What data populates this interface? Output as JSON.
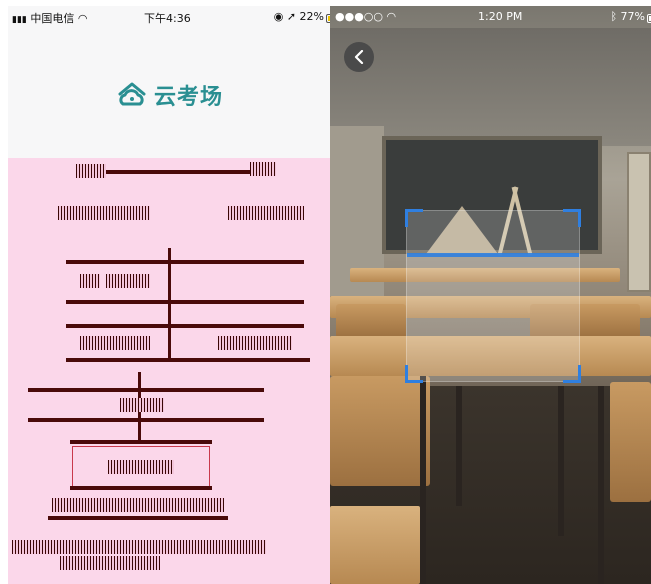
{
  "left_screen": {
    "status": {
      "carrier": "中国电信",
      "time": "下午4:36",
      "battery": "22%"
    },
    "logo": {
      "text": "云考场",
      "icon": "home-cloud-icon",
      "color": "#2a8f92"
    },
    "garbled_region_color": "#fbd7ea"
  },
  "right_screen": {
    "status": {
      "signal": "●●●○○",
      "time": "1:20 PM",
      "battery": "77%"
    },
    "back_icon": "chevron-left-icon",
    "scan_frame_color": "#2f7fe0"
  }
}
